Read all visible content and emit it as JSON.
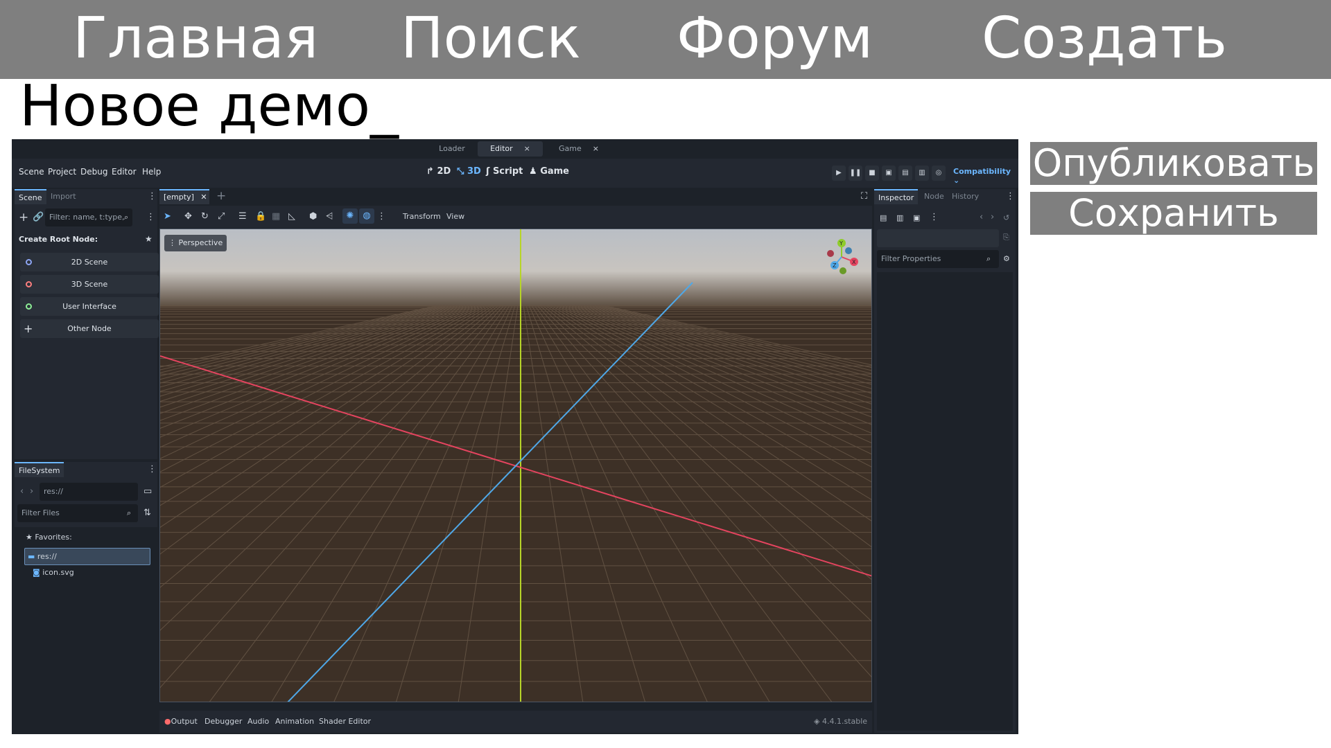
{
  "nav": {
    "items": [
      "Главная",
      "Поиск",
      "Форум",
      "Создать"
    ]
  },
  "project_title": "Новое демо_",
  "actions": {
    "publish": "Опубликовать",
    "save": "Сохранить"
  },
  "editor": {
    "window_tabs": [
      {
        "label": "Loader",
        "close": ""
      },
      {
        "label": "Editor",
        "close": "×"
      },
      {
        "label": "Game",
        "close": "×"
      }
    ],
    "menu": [
      "Scene",
      "Project",
      "Debug",
      "Editor",
      "Help"
    ],
    "workspaces": [
      {
        "label": "2D",
        "icon": "2d-icon"
      },
      {
        "label": "3D",
        "icon": "3d-icon",
        "active": true
      },
      {
        "label": "Script",
        "icon": "script-icon"
      },
      {
        "label": "Game",
        "icon": "game-icon"
      }
    ],
    "renderer": "Compatibility",
    "scene_panel": {
      "tabs": [
        "Scene",
        "Import"
      ],
      "filter_placeholder": "Filter: name, t:type,",
      "create_root_label": "Create Root Node:",
      "root_options": [
        {
          "label": "2D Scene",
          "color": "#8da5f3"
        },
        {
          "label": "3D Scene",
          "color": "#fc7f7f"
        },
        {
          "label": "User Interface",
          "color": "#8eef97"
        },
        {
          "label": "Other Node",
          "color": "#e0e0e0"
        }
      ]
    },
    "filesystem": {
      "tab": "FileSystem",
      "path": "res://",
      "filter_placeholder": "Filter Files",
      "favorites": "Favorites:",
      "root": "res://",
      "files": [
        "icon.svg"
      ]
    },
    "scene_tab": "[empty]",
    "toolbar": {
      "transform": "Transform",
      "view": "View"
    },
    "viewport_label": "Perspective",
    "gizmo_axes": [
      "Y",
      "X",
      "Z"
    ],
    "inspector": {
      "tabs": [
        "Inspector",
        "Node",
        "History"
      ],
      "filter_placeholder": "Filter Properties"
    },
    "bottom_tabs": [
      "Output",
      "Debugger",
      "Audio",
      "Animation",
      "Shader Editor"
    ],
    "version": "4.4.1.stable"
  }
}
